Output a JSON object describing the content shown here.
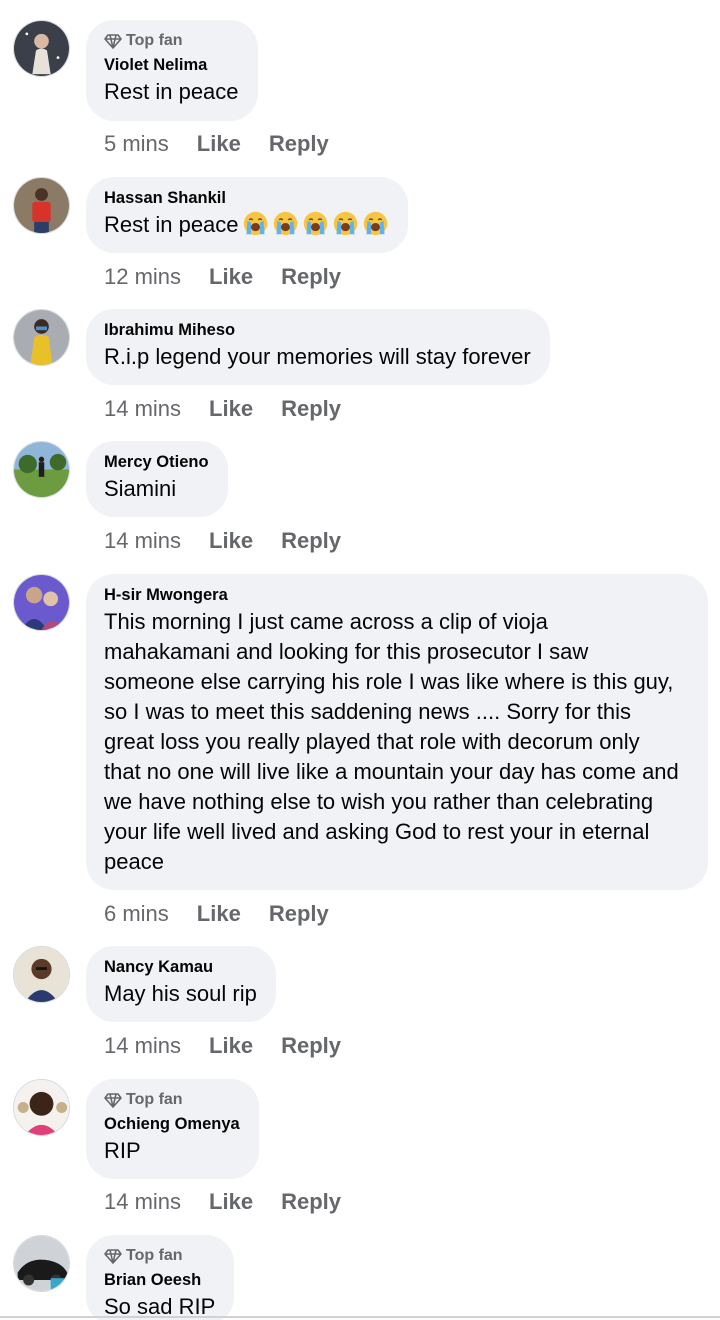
{
  "comments": [
    {
      "top_fan": true,
      "badge_label": "Top fan",
      "author": "Violet Nelima",
      "text": "Rest in peace",
      "time": "5 mins",
      "like": "Like",
      "reply": "Reply"
    },
    {
      "top_fan": false,
      "author": "Hassan Shankil",
      "text": "Rest in peace",
      "emoji_count": 5,
      "emoji_name": "loudly-crying-face",
      "time": "12 mins",
      "like": "Like",
      "reply": "Reply"
    },
    {
      "top_fan": false,
      "author": "Ibrahimu Miheso",
      "text": "R.i.p legend your memories will stay forever",
      "time": "14 mins",
      "like": "Like",
      "reply": "Reply"
    },
    {
      "top_fan": false,
      "author": "Mercy Otieno",
      "text": "Siamini",
      "time": "14 mins",
      "like": "Like",
      "reply": "Reply"
    },
    {
      "top_fan": false,
      "author": "H-sir Mwongera",
      "text": "This morning I just came across a clip of vioja\nmahakamani and looking for this prosecutor I saw\nsomeone else carrying his role I was like where is this guy,\nso I was to meet this saddening news .... Sorry for this\ngreat loss you really played that role with decorum only\nthat no one will live like a mountain your day has come and\nwe have nothing else to wish you rather than celebrating\nyour life well lived and asking God to rest your in eternal\npeace",
      "time": "6 mins",
      "like": "Like",
      "reply": "Reply"
    },
    {
      "top_fan": false,
      "author": "Nancy Kamau",
      "text": "May his soul rip",
      "time": "14 mins",
      "like": "Like",
      "reply": "Reply"
    },
    {
      "top_fan": true,
      "badge_label": "Top fan",
      "author": "Ochieng Omenya",
      "text": "RIP",
      "time": "14 mins",
      "like": "Like",
      "reply": "Reply"
    },
    {
      "top_fan": true,
      "badge_label": "Top fan",
      "author": "Brian Oeesh",
      "text": "So sad RIP",
      "time": "",
      "like": "",
      "reply": ""
    }
  ],
  "colors": {
    "bubble": "#f0f2f5",
    "secondary_text": "#65676b",
    "primary_text": "#050505"
  }
}
